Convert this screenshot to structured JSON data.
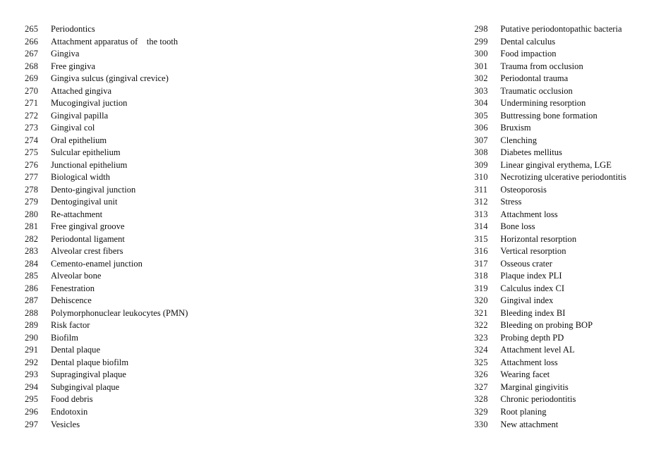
{
  "document": {
    "kind": "numbered-glossary",
    "subject": "Periodontics",
    "background_color": "#ffffff",
    "text_color": "#0d0d0d",
    "columns": [
      {
        "name": "left-column",
        "entries": [
          {
            "number": "265",
            "label": "Periodontics"
          },
          {
            "number": "266",
            "label": "Attachment apparatus of    the tooth"
          },
          {
            "number": "267",
            "label": "Gingiva"
          },
          {
            "number": "268",
            "label": "Free gingiva"
          },
          {
            "number": "269",
            "label": "Gingiva sulcus (gingival crevice)"
          },
          {
            "number": "270",
            "label": "Attached gingiva"
          },
          {
            "number": "271",
            "label": "Mucogingival juction"
          },
          {
            "number": "272",
            "label": "Gingival papilla"
          },
          {
            "number": "273",
            "label": "Gingival col"
          },
          {
            "number": "274",
            "label": "Oral epithelium"
          },
          {
            "number": "275",
            "label": "Sulcular epithelium"
          },
          {
            "number": "276",
            "label": "Junctional epithelium"
          },
          {
            "number": "277",
            "label": "Biological width"
          },
          {
            "number": "278",
            "label": "Dento-gingival junction"
          },
          {
            "number": "279",
            "label": "Dentogingival unit"
          },
          {
            "number": "280",
            "label": "Re-attachment"
          },
          {
            "number": "281",
            "label": "Free gingival groove"
          },
          {
            "number": "282",
            "label": "Periodontal ligament"
          },
          {
            "number": "283",
            "label": "Alveolar crest fibers"
          },
          {
            "number": "284",
            "label": "Cemento-enamel junction"
          },
          {
            "number": "285",
            "label": "Alveolar bone"
          },
          {
            "number": "286",
            "label": "Fenestration"
          },
          {
            "number": "287",
            "label": "Dehiscence"
          },
          {
            "number": "288",
            "label": "Polymorphonuclear leukocytes (PMN)"
          },
          {
            "number": "289",
            "label": "Risk factor"
          },
          {
            "number": "290",
            "label": "Biofilm"
          },
          {
            "number": "291",
            "label": "Dental plaque"
          },
          {
            "number": "292",
            "label": "Dental plaque biofilm"
          },
          {
            "number": "293",
            "label": "Supragingival plaque"
          },
          {
            "number": "294",
            "label": "Subgingival plaque"
          },
          {
            "number": "295",
            "label": "Food debris"
          },
          {
            "number": "296",
            "label": "Endotoxin"
          },
          {
            "number": "297",
            "label": "Vesicles"
          }
        ]
      },
      {
        "name": "right-column",
        "entries": [
          {
            "number": "298",
            "label": "Putative periodontopathic bacteria"
          },
          {
            "number": "299",
            "label": "Dental calculus"
          },
          {
            "number": "300",
            "label": "Food impaction"
          },
          {
            "number": "301",
            "label": "Trauma from occlusion"
          },
          {
            "number": "302",
            "label": "Periodontal trauma"
          },
          {
            "number": "303",
            "label": "Traumatic occlusion"
          },
          {
            "number": "304",
            "label": "Undermining resorption"
          },
          {
            "number": "305",
            "label": "Buttressing bone formation"
          },
          {
            "number": "306",
            "label": "Bruxism"
          },
          {
            "number": "307",
            "label": "Clenching"
          },
          {
            "number": "308",
            "label": "Diabetes mellitus"
          },
          {
            "number": "309",
            "label": "Linear gingival erythema, LGE"
          },
          {
            "number": "310",
            "label": "Necrotizing ulcerative periodontitis"
          },
          {
            "number": "311",
            "label": "Osteoporosis"
          },
          {
            "number": "312",
            "label": "Stress"
          },
          {
            "number": "313",
            "label": "Attachment loss"
          },
          {
            "number": "314",
            "label": "Bone loss"
          },
          {
            "number": "315",
            "label": "Horizontal resorption"
          },
          {
            "number": "316",
            "label": "Vertical resorption"
          },
          {
            "number": "317",
            "label": "Osseous crater"
          },
          {
            "number": "318",
            "label": "Plaque index PLI"
          },
          {
            "number": "319",
            "label": "Calculus index CI"
          },
          {
            "number": "320",
            "label": "Gingival index"
          },
          {
            "number": "321",
            "label": "Bleeding index BI"
          },
          {
            "number": "322",
            "label": "Bleeding on probing BOP"
          },
          {
            "number": "323",
            "label": "Probing depth PD"
          },
          {
            "number": "324",
            "label": "Attachment level AL"
          },
          {
            "number": "325",
            "label": "Attachment loss"
          },
          {
            "number": "326",
            "label": "Wearing facet"
          },
          {
            "number": "327",
            "label": "Marginal gingivitis"
          },
          {
            "number": "328",
            "label": "Chronic periodontitis"
          },
          {
            "number": "329",
            "label": "Root planing"
          },
          {
            "number": "330",
            "label": "New attachment"
          }
        ]
      }
    ]
  }
}
